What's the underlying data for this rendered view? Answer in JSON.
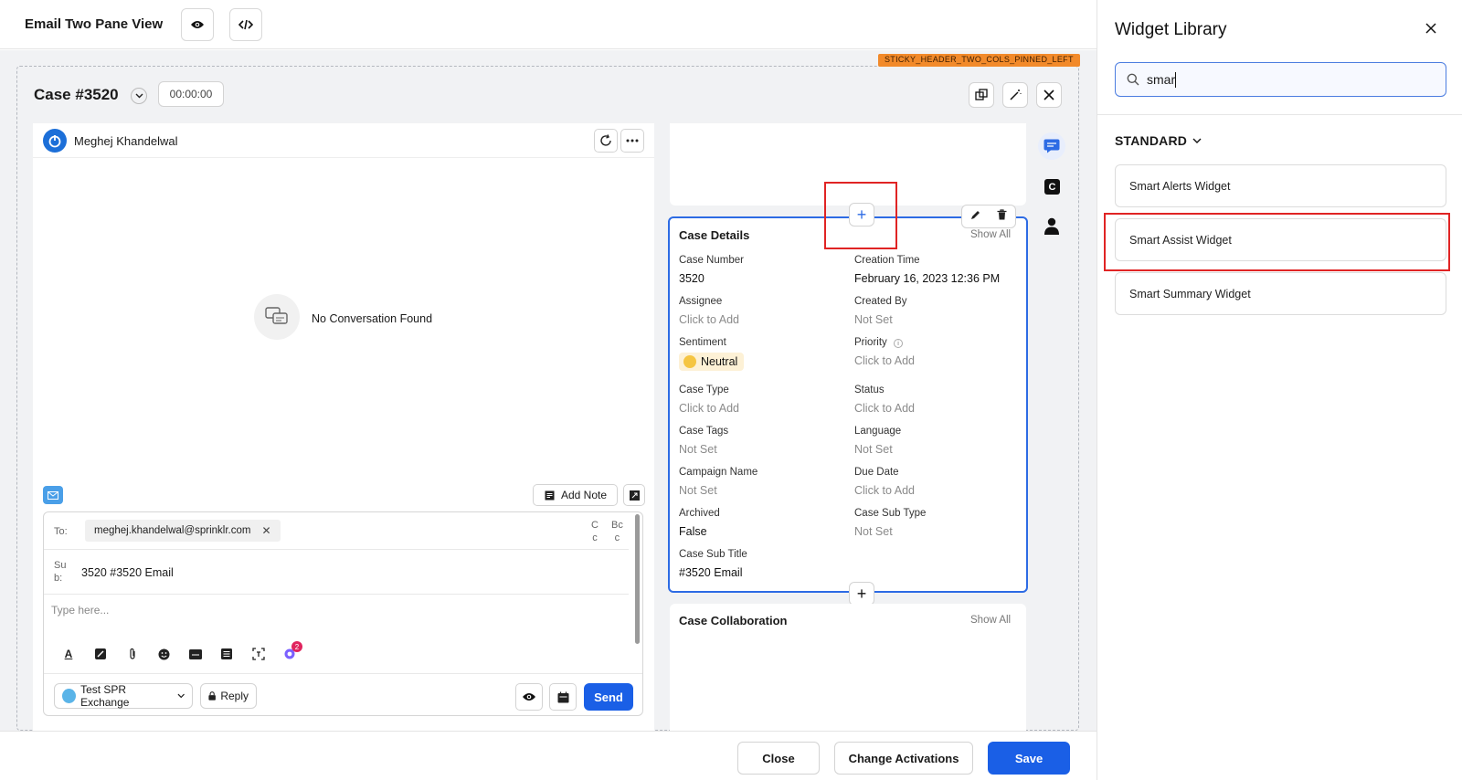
{
  "header": {
    "title": "Email Two Pane View",
    "preview_icon": "eye-icon",
    "code_icon": "code-icon"
  },
  "layout_tag": "STICKY_HEADER_TWO_COLS_PINNED_LEFT",
  "case": {
    "title": "Case #3520",
    "timer": "00:00:00"
  },
  "conversation": {
    "user_name": "Meghej Khandelwal",
    "empty_message": "No Conversation Found",
    "add_note_label": "Add Note"
  },
  "composer": {
    "to_label": "To:",
    "to_chip": "meghej.khandelwal@sprinklr.com",
    "cc_label_1": "C",
    "cc_label_2": "c",
    "bcc_label_1": "Bc",
    "bcc_label_2": "c",
    "sub_label_1": "Su",
    "sub_label_2": "b:",
    "subject": "3520 #3520 Email",
    "body_placeholder": "Type here...",
    "badge_count": "2",
    "account": "Test SPR Exchange",
    "reply_label": "Reply",
    "send_label": "Send"
  },
  "case_details": {
    "title": "Case Details",
    "show_all": "Show All",
    "fields": [
      {
        "label": "Case Number",
        "value": "3520",
        "empty": false
      },
      {
        "label": "Creation Time",
        "value": "February 16, 2023 12:36 PM",
        "empty": false
      },
      {
        "label": "Assignee",
        "value": "Click to Add",
        "empty": true
      },
      {
        "label": "Created By",
        "value": "Not Set",
        "empty": true
      },
      {
        "label": "Sentiment",
        "value": "Neutral",
        "empty": false
      },
      {
        "label": "Priority",
        "value": "Click to Add",
        "empty": true
      },
      {
        "label": "Case Type",
        "value": "Click to Add",
        "empty": true
      },
      {
        "label": "Status",
        "value": "Click to Add",
        "empty": true
      },
      {
        "label": "Case Tags",
        "value": "Not Set",
        "empty": true
      },
      {
        "label": "Language",
        "value": "Not Set",
        "empty": true
      },
      {
        "label": "Campaign Name",
        "value": "Not Set",
        "empty": true
      },
      {
        "label": "Due Date",
        "value": "Click to Add",
        "empty": true
      },
      {
        "label": "Archived",
        "value": "False",
        "empty": false
      },
      {
        "label": "Case Sub Type",
        "value": "Not Set",
        "empty": true
      },
      {
        "label": "Case Sub Title",
        "value": "#3520 Email",
        "empty": false
      }
    ]
  },
  "collaboration": {
    "title": "Case Collaboration",
    "show_all": "Show All"
  },
  "footer": {
    "close": "Close",
    "change_activations": "Change Activations",
    "save": "Save"
  },
  "library": {
    "title": "Widget Library",
    "search_value": "smar",
    "section": "STANDARD",
    "items": [
      "Smart Alerts Widget",
      "Smart Assist Widget",
      "Smart Summary Widget"
    ]
  },
  "colors": {
    "accent": "#1a5fe6",
    "highlight": "#e02424",
    "tag": "#f28a2a"
  }
}
